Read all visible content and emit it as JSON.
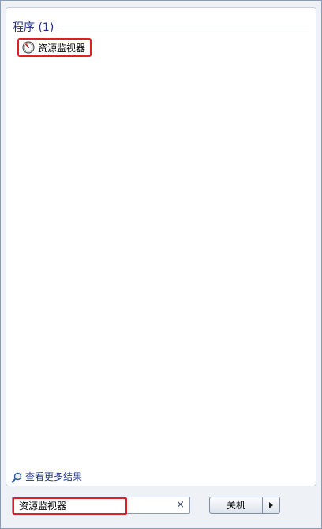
{
  "results": {
    "group_title": "程序 (1)",
    "items": [
      {
        "label": "资源监视器",
        "icon": "resource-monitor-icon"
      }
    ],
    "see_more_label": "查看更多结果"
  },
  "search": {
    "value": "资源监视器",
    "clear_symbol": "×"
  },
  "shutdown": {
    "label": "关机"
  },
  "colors": {
    "group_title": "#1e3287",
    "highlight": "#e02020",
    "menu_background": "#eef1f6"
  }
}
